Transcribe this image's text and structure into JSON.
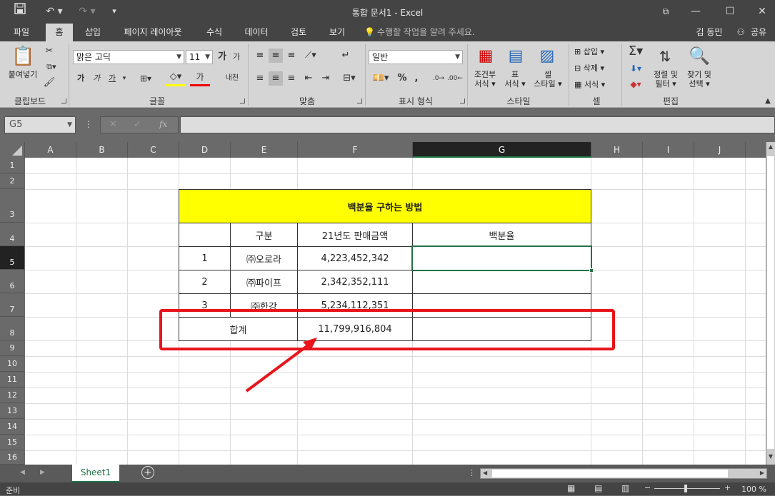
{
  "titlebar": {
    "title": "통합 문서1 - Excel",
    "save_icon": "save-icon",
    "undo_icon": "undo-icon",
    "redo_icon": "redo-icon"
  },
  "tabs": [
    {
      "label": "파일"
    },
    {
      "label": "홈",
      "active": true
    },
    {
      "label": "삽입"
    },
    {
      "label": "페이지 레이아웃"
    },
    {
      "label": "수식"
    },
    {
      "label": "데이터"
    },
    {
      "label": "검토"
    },
    {
      "label": "보기"
    }
  ],
  "tellme": "수행할 작업을 알려 주세요.",
  "user": "김 동민",
  "share": "공유",
  "ribbon": {
    "clipboard": {
      "paste": "붙여넣기",
      "label": "클립보드"
    },
    "font": {
      "name": "맑은 고딕",
      "size": "11",
      "label": "글꼴",
      "bold": "가",
      "italic": "가",
      "underline": "가",
      "grow": "가",
      "shrink": "가",
      "fontcolor": "가",
      "phonetic": "내천"
    },
    "align": {
      "label": "맞춤"
    },
    "number": {
      "format": "일반",
      "label": "표시 형식",
      "percent": "%"
    },
    "styles": {
      "cond": "조건부\n서식",
      "cond1": "조건부",
      "cond2": "서식",
      "table1": "표",
      "table2": "서식",
      "cell1": "셀",
      "cell2": "스타일",
      "label": "스타일"
    },
    "cells": {
      "insert": "삽입",
      "delete": "삭제",
      "format": "서식",
      "label": "셀"
    },
    "edit": {
      "sort1": "정렬 및",
      "sort2": "필터",
      "find1": "찾기 및",
      "find2": "선택",
      "label": "편집"
    }
  },
  "formula": {
    "namebox": "G5",
    "value": ""
  },
  "columns": [
    "A",
    "B",
    "C",
    "D",
    "E",
    "F",
    "G",
    "H",
    "I",
    "J"
  ],
  "rows": [
    "1",
    "2",
    "3",
    "4",
    "5",
    "6",
    "7",
    "8",
    "9",
    "10",
    "11",
    "12",
    "13",
    "14",
    "15",
    "16"
  ],
  "table": {
    "title": "백분율 구하는 방법",
    "headers": [
      "",
      "구분",
      "21년도 판매금액",
      "백분율"
    ],
    "data": [
      {
        "no": "1",
        "name": "㈜오로라",
        "amount": "4,223,452,342",
        "pct": ""
      },
      {
        "no": "2",
        "name": "㈜파이프",
        "amount": "2,342,352,111",
        "pct": ""
      },
      {
        "no": "3",
        "name": "㈜한강",
        "amount": "5,234,112,351",
        "pct": ""
      }
    ],
    "total_label": "합계",
    "total_value": "11,799,916,804"
  },
  "sheet": {
    "name": "Sheet1"
  },
  "status": {
    "ready": "준비",
    "zoom": "100 %"
  },
  "colors": {
    "title_fill": "#ffff00",
    "highlight": "#e8151b",
    "accent": "#217346"
  }
}
